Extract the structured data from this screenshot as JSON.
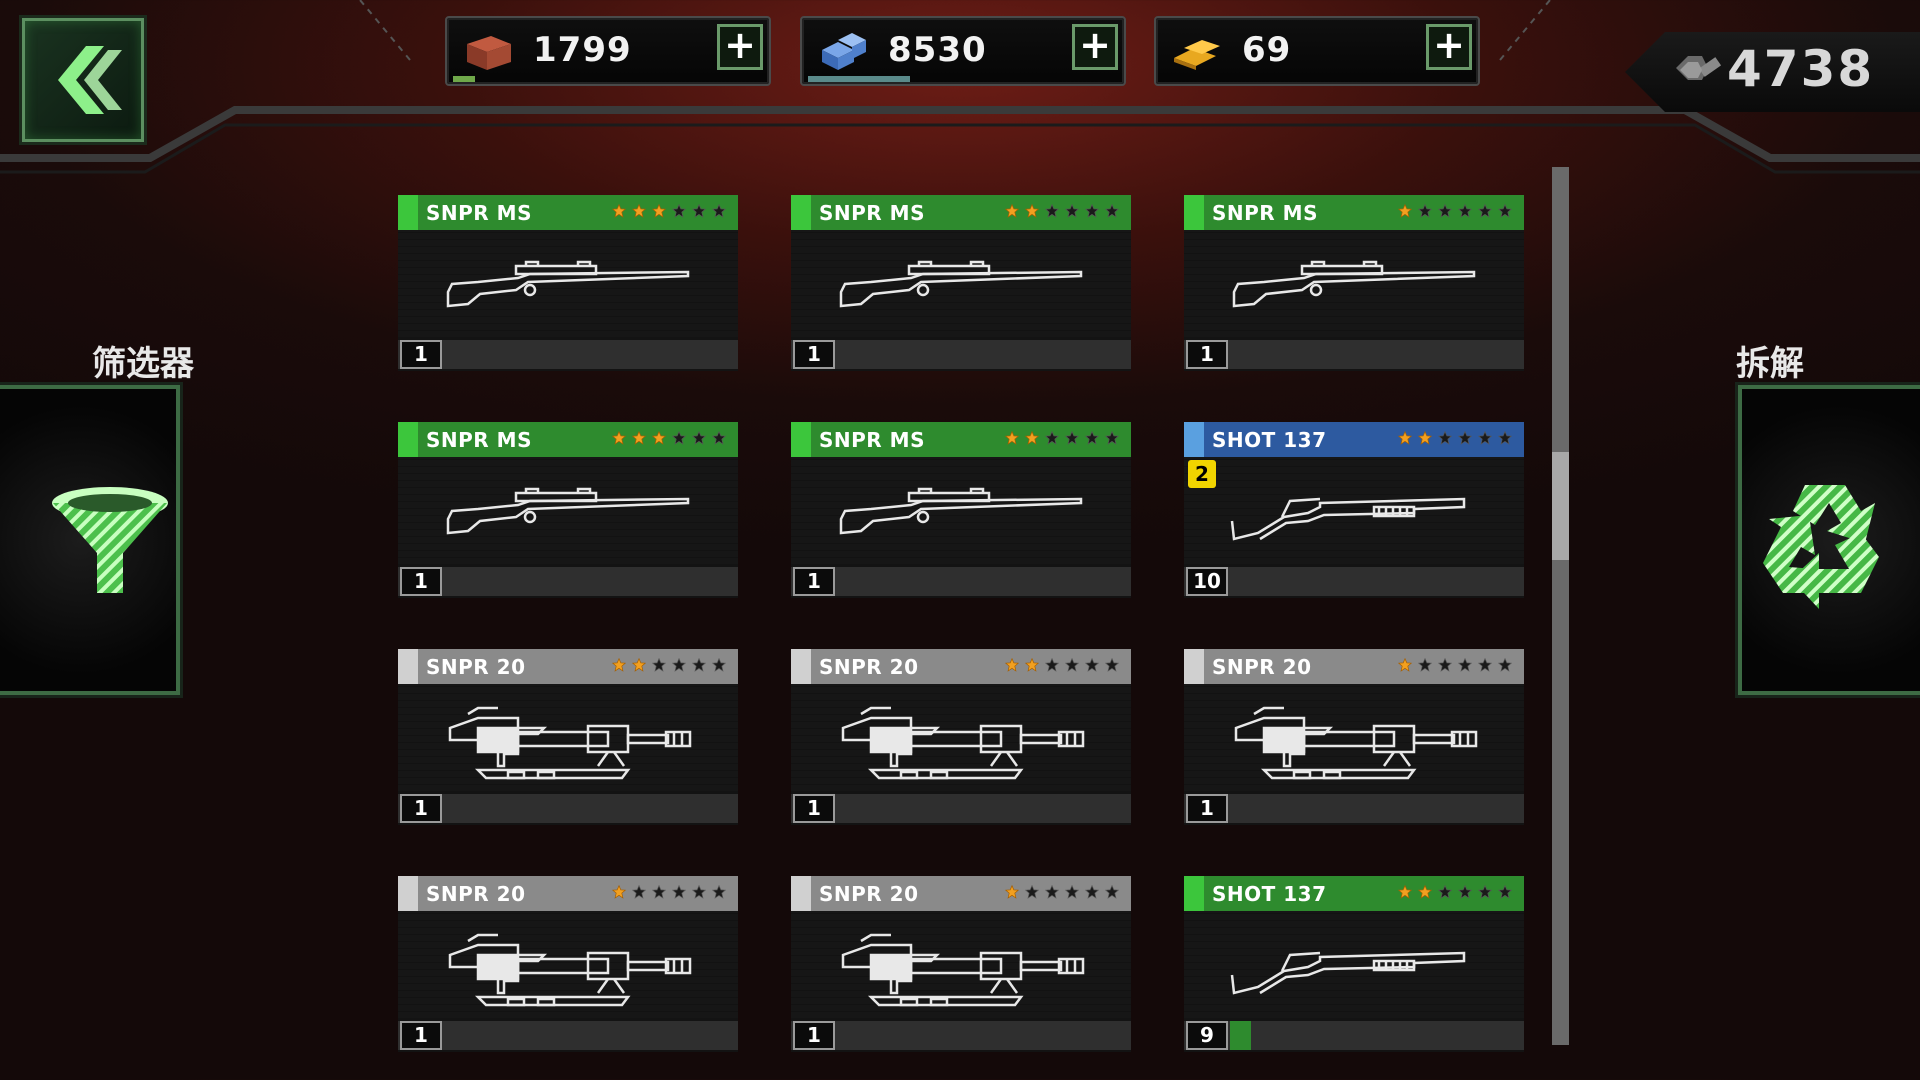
{
  "top_bar": {
    "currencies": [
      {
        "name": "resource-crates",
        "icon": "crate-icon",
        "value": "1799",
        "bar_fraction": 0.07,
        "bar_color": "#6fa84a"
      },
      {
        "name": "blue-cubes",
        "icon": "cube-stack-icon",
        "value": "8530",
        "bar_fraction": 0.33,
        "bar_color": "#5a8a8a"
      },
      {
        "name": "gold",
        "icon": "gold-bar-icon",
        "value": "69",
        "bar_fraction": 0,
        "bar_color": "#b07a20"
      }
    ],
    "scrap": {
      "icon": "bolt-icon",
      "value": "4738"
    }
  },
  "left": {
    "label": "筛选器",
    "icon": "funnel-icon"
  },
  "right": {
    "label": "拆解",
    "icon": "recycle-icon"
  },
  "colors": {
    "green": "#2e8b2e",
    "green_accent": "#3cc63c",
    "blue": "#2d5aa0",
    "blue_accent": "#5aa0e0",
    "gray": "#8a8a8a",
    "gray_accent": "#d0d0d0",
    "star_on": "#f2a020",
    "star_off": "#1a1a1a"
  },
  "cards": [
    {
      "name": "SNPR MS",
      "rarity": "green",
      "stars": 3,
      "weapon": "rifle",
      "count": "1",
      "progress": 0
    },
    {
      "name": "SNPR MS",
      "rarity": "green",
      "stars": 2,
      "weapon": "rifle",
      "count": "1",
      "progress": 0
    },
    {
      "name": "SNPR MS",
      "rarity": "green",
      "stars": 1,
      "weapon": "rifle",
      "count": "1",
      "progress": 0
    },
    {
      "name": "SNPR MS",
      "rarity": "green",
      "stars": 3,
      "weapon": "rifle",
      "count": "1",
      "progress": 0
    },
    {
      "name": "SNPR MS",
      "rarity": "green",
      "stars": 2,
      "weapon": "rifle",
      "count": "1",
      "progress": 0
    },
    {
      "name": "SHOT 137",
      "rarity": "blue",
      "stars": 2,
      "weapon": "shotgun",
      "count": "10",
      "progress": 0,
      "badge": "2"
    },
    {
      "name": "SNPR 20",
      "rarity": "gray",
      "stars": 2,
      "weapon": "heavy",
      "count": "1",
      "progress": 0
    },
    {
      "name": "SNPR 20",
      "rarity": "gray",
      "stars": 2,
      "weapon": "heavy",
      "count": "1",
      "progress": 0
    },
    {
      "name": "SNPR 20",
      "rarity": "gray",
      "stars": 1,
      "weapon": "heavy",
      "count": "1",
      "progress": 0
    },
    {
      "name": "SNPR 20",
      "rarity": "gray",
      "stars": 1,
      "weapon": "heavy",
      "count": "1",
      "progress": 0
    },
    {
      "name": "SNPR 20",
      "rarity": "gray",
      "stars": 1,
      "weapon": "heavy",
      "count": "1",
      "progress": 0
    },
    {
      "name": "SHOT 137",
      "rarity": "green",
      "stars": 2,
      "weapon": "shotgun",
      "count": "9",
      "progress": 0.07
    }
  ],
  "scroll": {
    "position_fraction": 0.37
  }
}
